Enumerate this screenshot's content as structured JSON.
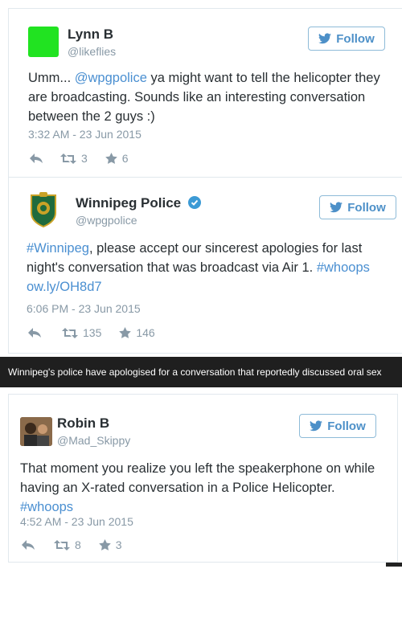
{
  "colors": {
    "accent": "#4a8fd1",
    "muted": "#8899a6",
    "caption_bg": "#1f1f1f",
    "avatar_green": "#21e321"
  },
  "follow_label": "Follow",
  "tweets": [
    {
      "name": "Lynn B",
      "handle": "@likeflies",
      "text_parts": [
        "Umm... ",
        "@wpgpolice",
        " ya might want to tell the helicopter they are broadcasting. Sounds like an interesting conversation between the 2 guys :)"
      ],
      "timestamp": "3:32 AM - 23 Jun 2015",
      "retweets": "3",
      "favorites": "6"
    },
    {
      "name": "Winnipeg Police",
      "handle": "@wpgpolice",
      "verified": true,
      "text_parts": [
        "#Winnipeg",
        ", please accept our sincerest apologies for last night's conversation that was broadcast via Air 1. ",
        "#whoops",
        " ",
        "ow.ly/OH8d7"
      ],
      "timestamp": "6:06 PM - 23 Jun 2015",
      "retweets": "135",
      "favorites": "146"
    },
    {
      "name": "Robin B",
      "handle": "@Mad_Skippy",
      "text_parts": [
        "That moment you realize you left the speakerphone on while having an X-rated conversation in a Police Helicopter. ",
        "#whoops"
      ],
      "timestamp": "4:52 AM - 23 Jun 2015",
      "retweets": "8",
      "favorites": "3"
    }
  ],
  "caption": "Winnipeg's police have apologised for a conversation that reportedly discussed oral sex"
}
